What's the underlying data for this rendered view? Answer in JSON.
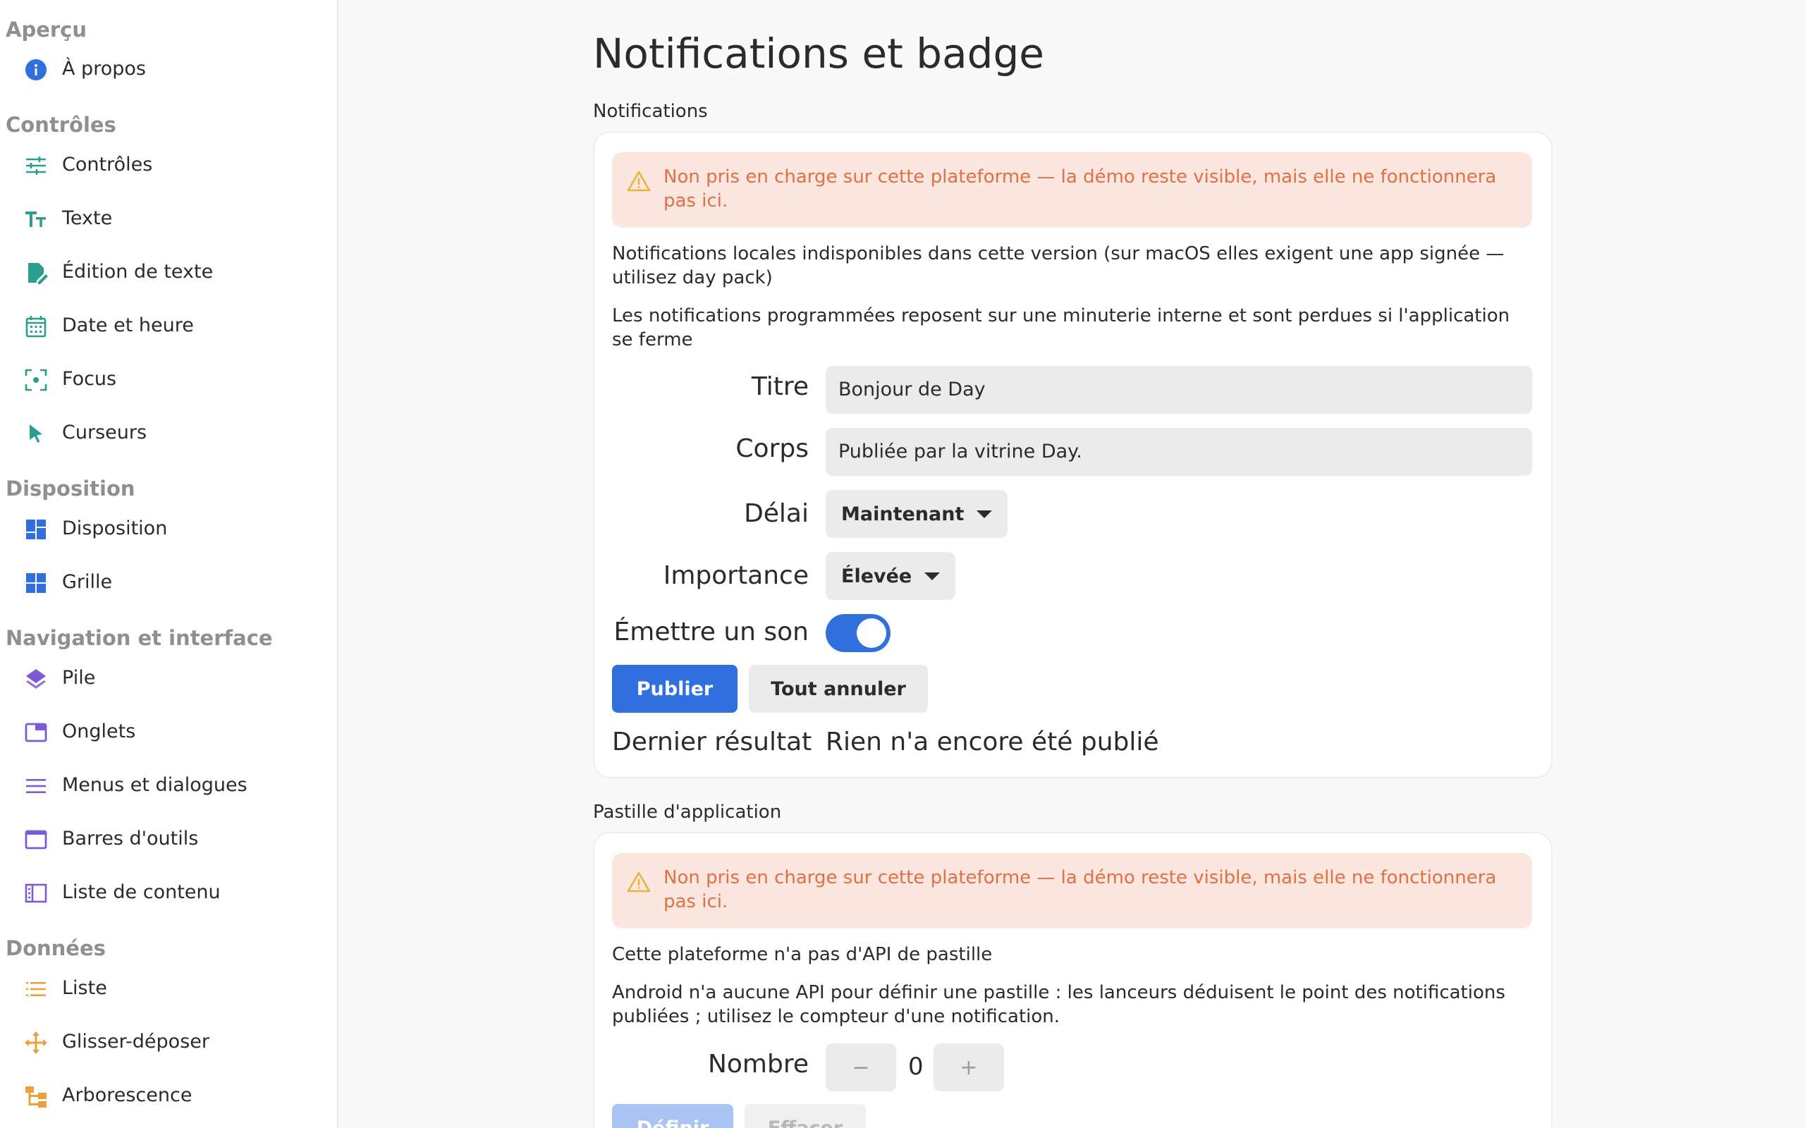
{
  "sidebar": {
    "sections": [
      {
        "title": "Aperçu"
      },
      {
        "title": "Contrôles"
      },
      {
        "title": "Disposition"
      },
      {
        "title": "Navigation et interface"
      },
      {
        "title": "Données"
      }
    ],
    "items": [
      {
        "label": "À propos",
        "icon": "info-icon",
        "color": "#2f6fde"
      },
      {
        "label": "Contrôles",
        "icon": "sliders-icon",
        "color": "#2a9d8f"
      },
      {
        "label": "Texte",
        "icon": "text-size-icon",
        "color": "#2a9d8f"
      },
      {
        "label": "Édition de texte",
        "icon": "edit-document-icon",
        "color": "#2a9d8f"
      },
      {
        "label": "Date et heure",
        "icon": "calendar-icon",
        "color": "#2a9d8f"
      },
      {
        "label": "Focus",
        "icon": "focus-icon",
        "color": "#2a9d8f"
      },
      {
        "label": "Curseurs",
        "icon": "cursor-icon",
        "color": "#2a9d8f"
      },
      {
        "label": "Disposition",
        "icon": "dashboard-icon",
        "color": "#2f6fde"
      },
      {
        "label": "Grille",
        "icon": "grid-icon",
        "color": "#2f6fde"
      },
      {
        "label": "Pile",
        "icon": "layers-icon",
        "color": "#7b5bd6"
      },
      {
        "label": "Onglets",
        "icon": "tab-icon",
        "color": "#7b5bd6"
      },
      {
        "label": "Menus et dialogues",
        "icon": "menu-icon",
        "color": "#7b5bd6"
      },
      {
        "label": "Barres d'outils",
        "icon": "window-icon",
        "color": "#7b5bd6"
      },
      {
        "label": "Liste de contenu",
        "icon": "list-detail-icon",
        "color": "#7b5bd6"
      },
      {
        "label": "Liste",
        "icon": "list-icon",
        "color": "#e9a23b"
      },
      {
        "label": "Glisser-déposer",
        "icon": "move-icon",
        "color": "#e9a23b"
      },
      {
        "label": "Arborescence",
        "icon": "tree-icon",
        "color": "#e9a23b"
      }
    ]
  },
  "main": {
    "title": "Notifications et badge",
    "notifications": {
      "group_title": "Notifications",
      "warning": "Non pris en charge sur cette plateforme — la démo reste visible, mais elle ne fonctionnera pas ici.",
      "para1": "Notifications locales indisponibles dans cette version (sur macOS elles exigent une app signée — utilisez day pack)",
      "para2": "Les notifications programmées reposent sur une minuterie interne et sont perdues si l'application se ferme",
      "title_label": "Titre",
      "title_value": "Bonjour de Day",
      "body_label": "Corps",
      "body_value": "Publiée par la vitrine Day.",
      "delay_label": "Délai",
      "delay_value": "Maintenant",
      "importance_label": "Importance",
      "importance_value": "Élevée",
      "sound_label": "Émettre un son",
      "sound_on": true,
      "publish_label": "Publier",
      "cancel_all_label": "Tout annuler",
      "result_label": "Dernier résultat",
      "result_value": "Rien n'a encore été publié"
    },
    "badge": {
      "group_title": "Pastille d'application",
      "warning": "Non pris en charge sur cette plateforme — la démo reste visible, mais elle ne fonctionnera pas ici.",
      "para1": "Cette plateforme n'a pas d'API de pastille",
      "para2": "Android n'a aucune API pour définir une pastille : les lanceurs déduisent le point des notifications publiées ; utilisez le compteur d'une notification.",
      "count_label": "Nombre",
      "count_value": "0",
      "decrement_label": "−",
      "increment_label": "+",
      "set_label": "Définir",
      "clear_label": "Effacer"
    }
  },
  "colors": {
    "accent": "#2f6fde",
    "warning_bg": "#fbe6e0",
    "warning_text": "#e36f43",
    "warning_icon": "#e9b43b"
  }
}
